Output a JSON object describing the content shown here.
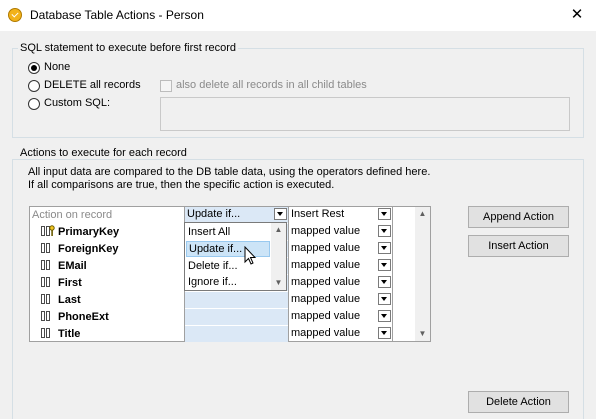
{
  "window": {
    "title": "Database Table Actions - Person",
    "close_glyph": "✕"
  },
  "sql_group": {
    "legend": "SQL statement to execute before first record",
    "options": [
      {
        "label": "None",
        "selected": true
      },
      {
        "label": "DELETE all records",
        "selected": false
      },
      {
        "label": "Custom SQL:",
        "selected": false
      }
    ],
    "child_tables_checkbox": {
      "label": "also delete all records in all child tables",
      "checked": false,
      "enabled": false
    },
    "custom_sql_value": ""
  },
  "actions_group": {
    "legend": "Actions to execute for each record",
    "description_line1": "All input data are compared to the DB table data, using the operators defined here.",
    "description_line2": "If all comparisons are true, then the specific action is executed."
  },
  "grid": {
    "header": {
      "action_label": "Action on record",
      "col1_value": "Update if...",
      "col2_value": "Insert Rest"
    },
    "rows": [
      {
        "field": "PrimaryKey",
        "is_key": true,
        "col1": "",
        "col2": "mapped value"
      },
      {
        "field": "ForeignKey",
        "is_key": false,
        "col1": "",
        "col2": "mapped value"
      },
      {
        "field": "EMail",
        "is_key": false,
        "col1": "",
        "col2": "mapped value"
      },
      {
        "field": "First",
        "is_key": false,
        "col1": "",
        "col2": "mapped value"
      },
      {
        "field": "Last",
        "is_key": false,
        "col1": "",
        "col2": "mapped value"
      },
      {
        "field": "PhoneExt",
        "is_key": false,
        "col1": "",
        "col2": "mapped value"
      },
      {
        "field": "Title",
        "is_key": false,
        "col1": "",
        "col2": "mapped value"
      }
    ]
  },
  "dropdown": {
    "items": [
      "Insert All",
      "Update if...",
      "Delete if...",
      "Ignore if..."
    ],
    "highlighted": "Update if..."
  },
  "buttons": {
    "append": "Append Action",
    "insert": "Insert Action",
    "delete": "Delete Action"
  },
  "colors": {
    "selection": "#cce4f7",
    "column_fill": "#dbe8f6",
    "group_border": "#d5dfe5"
  }
}
